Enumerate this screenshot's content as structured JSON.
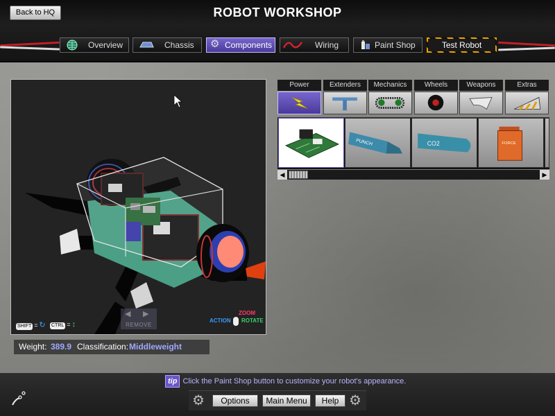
{
  "header": {
    "back_label": "Back to HQ",
    "title": "ROBOT WORKSHOP"
  },
  "tabs": [
    {
      "label": "Overview",
      "icon": "globe-icon",
      "active": false
    },
    {
      "label": "Chassis",
      "icon": "chassis-icon",
      "active": false
    },
    {
      "label": "Components",
      "icon": "gear-icon",
      "active": true
    },
    {
      "label": "Wiring",
      "icon": "wire-icon",
      "active": false
    },
    {
      "label": "Paint Shop",
      "icon": "paint-can-icon",
      "active": false
    },
    {
      "label": "Test Robot",
      "icon": "hazard-stripe-icon",
      "active": false
    }
  ],
  "viewport": {
    "remove_label": "REMOVE",
    "shift_key": "SHIFT",
    "ctrl_key": "CTRL",
    "equals": "=",
    "action_label": "ACTION",
    "zoom_label": "ZOOM",
    "rotate_label": "ROTATE"
  },
  "stats": {
    "weight_label": "Weight:",
    "weight_value": "389.9",
    "class_label": "Classification:",
    "class_value": "Middleweight"
  },
  "categories": [
    {
      "label": "Power",
      "icon": "lightning-icon",
      "active": true
    },
    {
      "label": "Extenders",
      "icon": "extender-bar-icon",
      "active": false
    },
    {
      "label": "Mechanics",
      "icon": "chain-drive-icon",
      "active": false
    },
    {
      "label": "Wheels",
      "icon": "wheel-icon",
      "active": false
    },
    {
      "label": "Weapons",
      "icon": "blade-icon",
      "active": false
    },
    {
      "label": "Extras",
      "icon": "wedge-icon",
      "active": false
    }
  ],
  "items": [
    {
      "name": "circuit-board-item",
      "selected": true
    },
    {
      "name": "battery-canister-item",
      "selected": false,
      "text": "PUNCH"
    },
    {
      "name": "co2-tank-item",
      "selected": false,
      "text": "CO2"
    },
    {
      "name": "power-box-item",
      "selected": false,
      "text": "FORCE"
    }
  ],
  "tip": {
    "badge": "tip",
    "text": "Click the Paint Shop button to customize your robot's appearance."
  },
  "bottom_buttons": {
    "options": "Options",
    "main_menu": "Main Menu",
    "help": "Help"
  },
  "colors": {
    "accent": "#6a55c8",
    "value_text": "#9fa8ff",
    "hazard": "#f2a100"
  }
}
